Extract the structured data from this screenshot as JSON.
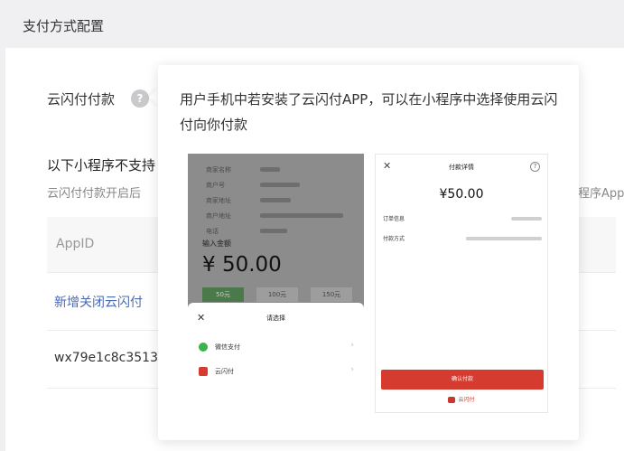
{
  "page": {
    "title": "支付方式配置"
  },
  "config": {
    "row_label": "云闪付付款",
    "help_icon": "?"
  },
  "section": {
    "title": "以下小程序不支持",
    "desc": "云闪付付款开启后",
    "desc_tail": "程序AppID"
  },
  "table": {
    "header": "AppID",
    "rows": [
      {
        "text": "新增关闭云闪付"
      },
      {
        "text": "wx79e1c8c3513"
      }
    ]
  },
  "tooltip": {
    "text": "用户手机中若安装了云闪付APP，可以在小程序中选择使用云闪付向你付款",
    "left_mock": {
      "info_labels": [
        "商家名称",
        "商户号",
        "商家地址",
        "商户地址",
        "电话"
      ],
      "input_label": "输入金额",
      "amount": "¥ 50.00",
      "quick_buttons": [
        "50元",
        "100元",
        "150元"
      ],
      "sheet": {
        "close": "✕",
        "title": "请选择",
        "options": [
          {
            "label": "微信支付",
            "color": "#3cb34a"
          },
          {
            "label": "云闪付",
            "color": "#d63b2f"
          }
        ],
        "chevron": "›"
      }
    },
    "right_mock": {
      "close": "✕",
      "title": "付款详情",
      "help": "?",
      "amount": "¥50.00",
      "rows": [
        {
          "label": "订单信息"
        },
        {
          "label": "付款方式"
        }
      ],
      "button": "确认付款",
      "footer": "云闪付"
    }
  }
}
